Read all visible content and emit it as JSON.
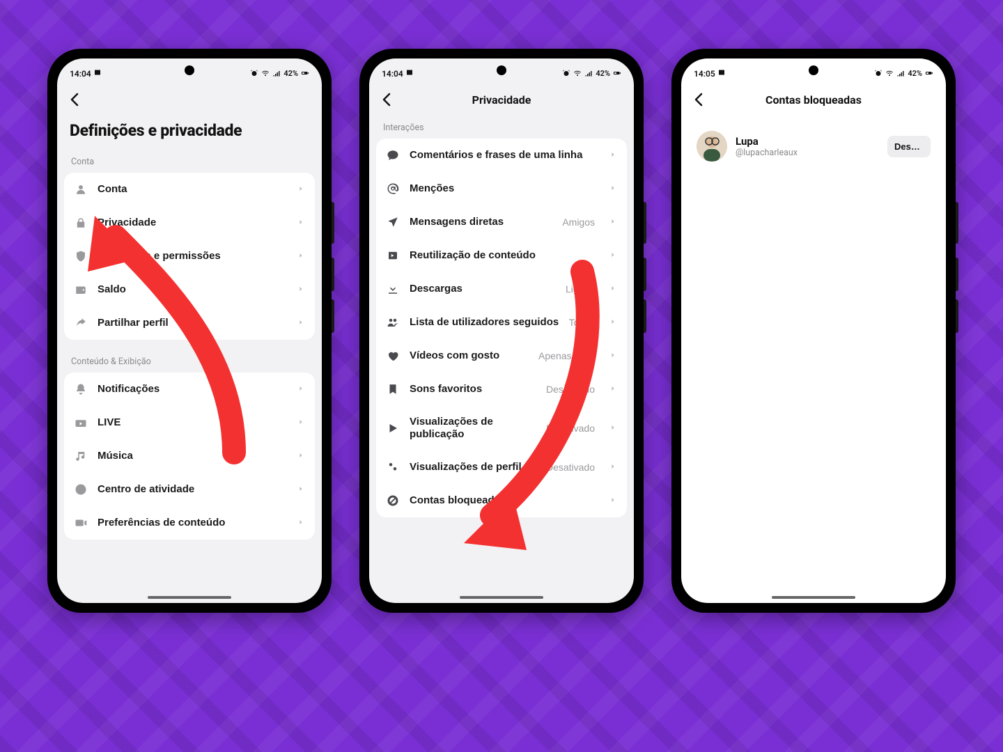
{
  "colors": {
    "accent": "#f43131",
    "bg": "#7a2fd4"
  },
  "status": {
    "time_a": "14:04",
    "time_b": "14:04",
    "time_c": "14:05",
    "battery": "42%"
  },
  "screen1": {
    "page_title": "Definições e privacidade",
    "sections": [
      {
        "label": "Conta",
        "items": [
          {
            "icon": "person",
            "label": "Conta"
          },
          {
            "icon": "lock",
            "label": "Privacidade"
          },
          {
            "icon": "shield",
            "label": "Segurança e permissões"
          },
          {
            "icon": "wallet",
            "label": "Saldo"
          },
          {
            "icon": "share",
            "label": "Partilhar perfil"
          }
        ]
      },
      {
        "label": "Conteúdo & Exibição",
        "items": [
          {
            "icon": "bell",
            "label": "Notificações"
          },
          {
            "icon": "live",
            "label": "LIVE"
          },
          {
            "icon": "music",
            "label": "Música"
          },
          {
            "icon": "clock",
            "label": "Centro de atividade"
          },
          {
            "icon": "video",
            "label": "Preferências de conteúdo"
          }
        ]
      }
    ]
  },
  "screen2": {
    "header_title": "Privacidade",
    "section_label": "Interações",
    "items": [
      {
        "icon": "comment",
        "label": "Comentários e frases de uma linha",
        "value": ""
      },
      {
        "icon": "at",
        "label": "Menções",
        "value": ""
      },
      {
        "icon": "paper",
        "label": "Mensagens diretas",
        "value": "Amigos"
      },
      {
        "icon": "reuse",
        "label": "Reutilização de conteúdo",
        "value": ""
      },
      {
        "icon": "download",
        "label": "Descargas",
        "value": "Ligado"
      },
      {
        "icon": "people",
        "label": "Lista de utilizadores seguidos",
        "value": "Todos"
      },
      {
        "icon": "heart",
        "label": "Vídeos com gosto",
        "value": "Apenas você"
      },
      {
        "icon": "bookmark",
        "label": "Sons favoritos",
        "value": "Desativado"
      },
      {
        "icon": "play",
        "label": "Visualizações de publicação",
        "value": "Desativado"
      },
      {
        "icon": "steps",
        "label": "Visualizações de perfil",
        "value": "Desativado"
      },
      {
        "icon": "block",
        "label": "Contas bloqueadas",
        "value": ""
      }
    ]
  },
  "screen3": {
    "header_title": "Contas bloqueadas",
    "blocked": [
      {
        "display_name": "Lupa",
        "username": "@lupacharleaux",
        "button": "Desbloquear"
      }
    ]
  }
}
